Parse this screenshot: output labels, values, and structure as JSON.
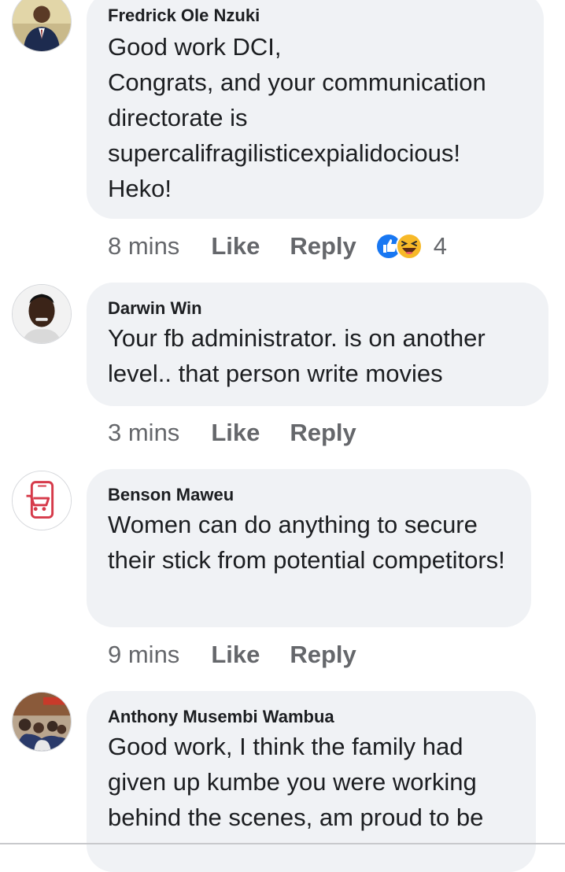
{
  "comments": [
    {
      "author": "Fredrick Ole Nzuki",
      "text": "Good work DCI,\nCongrats, and your communication directorate is supercalifragilisticexpialidocious!\nHeko!",
      "time": "8 mins",
      "like_label": "Like",
      "reply_label": "Reply",
      "reaction_count": "4",
      "reactions": [
        "like-reaction-icon",
        "haha-reaction-icon"
      ]
    },
    {
      "author": "Darwin Win",
      "text": "Your fb administrator. is on another level.. that person write movies",
      "time": "3 mins",
      "like_label": "Like",
      "reply_label": "Reply"
    },
    {
      "author": "Benson Maweu",
      "text": "Women can do anything to secure their stick from potential competitors!",
      "time": "9 mins",
      "like_label": "Like",
      "reply_label": "Reply"
    },
    {
      "author": "Anthony Musembi Wambua",
      "text": "Good work, I think the family had given up kumbe you were working behind the scenes, am proud to be"
    }
  ],
  "colors": {
    "bubble": "#f0f2f5",
    "meta_text": "#65676b",
    "like_blue": "#1877f2",
    "haha_yellow": "#f7b928"
  }
}
